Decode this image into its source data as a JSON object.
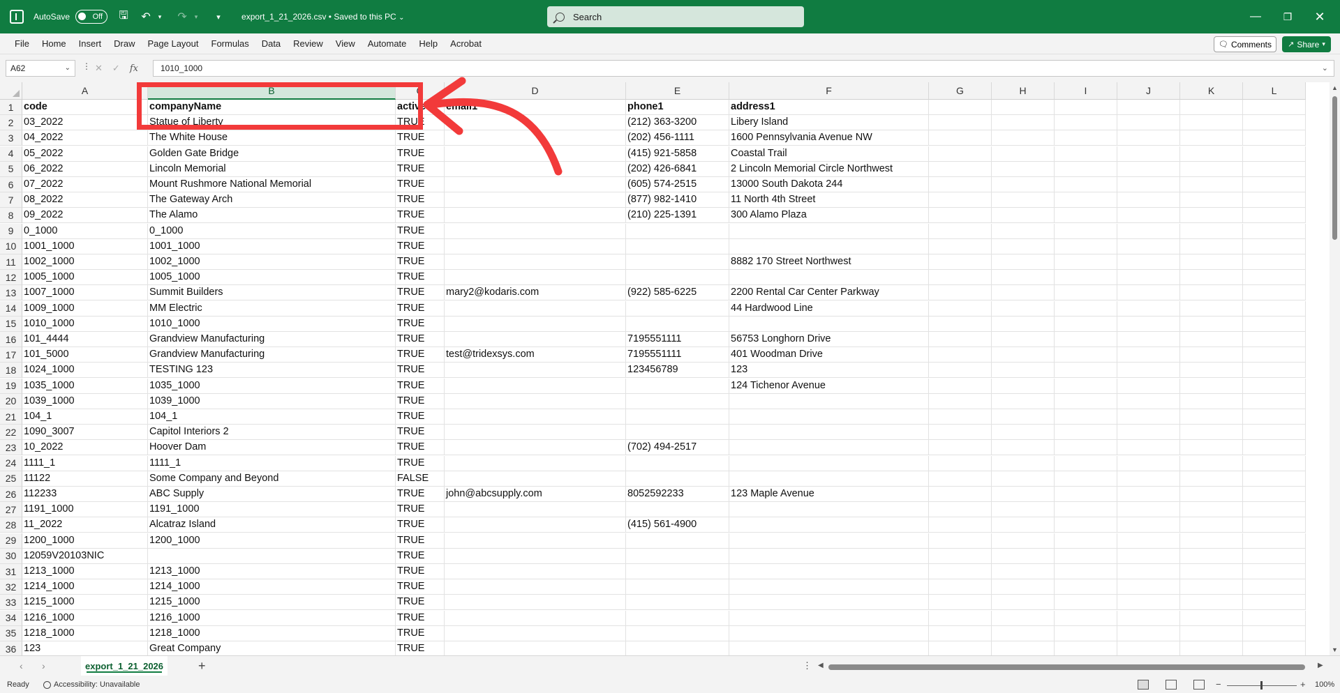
{
  "titlebar": {
    "autosave_label": "AutoSave",
    "autosave_state": "Off",
    "filename": "export_1_21_2026.csv • Saved to this PC",
    "search_placeholder": "Search"
  },
  "menu": [
    "File",
    "Home",
    "Insert",
    "Draw",
    "Page Layout",
    "Formulas",
    "Data",
    "Review",
    "View",
    "Automate",
    "Help",
    "Acrobat"
  ],
  "menu_buttons": {
    "comments": "Comments",
    "share": "Share"
  },
  "formula_bar": {
    "name_box": "A62",
    "formula": "1010_1000"
  },
  "columns": [
    {
      "letter": "A"
    },
    {
      "letter": "B"
    },
    {
      "letter": "C"
    },
    {
      "letter": "D"
    },
    {
      "letter": "E"
    },
    {
      "letter": "F"
    },
    {
      "letter": "G"
    },
    {
      "letter": "H"
    },
    {
      "letter": "I"
    },
    {
      "letter": "J"
    },
    {
      "letter": "K"
    },
    {
      "letter": "L"
    }
  ],
  "rows": [
    {
      "num": "1",
      "cells": [
        "code",
        "companyName",
        "active",
        "email1",
        "phone1",
        "address1"
      ]
    },
    {
      "num": "2",
      "cells": [
        "03_2022",
        "Statue of Liberty",
        "TRUE",
        "",
        "(212) 363-3200",
        "Libery Island"
      ]
    },
    {
      "num": "3",
      "cells": [
        "04_2022",
        "The White House",
        "TRUE",
        "",
        "(202) 456-1111",
        "1600 Pennsylvania Avenue NW"
      ]
    },
    {
      "num": "4",
      "cells": [
        "05_2022",
        "Golden Gate Bridge",
        "TRUE",
        "",
        "(415) 921-5858",
        "Coastal Trail"
      ]
    },
    {
      "num": "5",
      "cells": [
        "06_2022",
        "Lincoln Memorial",
        "TRUE",
        "",
        "(202) 426-6841",
        "2 Lincoln Memorial Circle Northwest"
      ]
    },
    {
      "num": "6",
      "cells": [
        "07_2022",
        "Mount Rushmore National Memorial",
        "TRUE",
        "",
        "(605) 574-2515",
        "13000 South Dakota 244"
      ]
    },
    {
      "num": "7",
      "cells": [
        "08_2022",
        "The Gateway Arch",
        "TRUE",
        "",
        "(877) 982-1410",
        "11 North 4th Street"
      ]
    },
    {
      "num": "8",
      "cells": [
        "09_2022",
        "The Alamo",
        "TRUE",
        "",
        "(210) 225-1391",
        "300 Alamo Plaza"
      ]
    },
    {
      "num": "9",
      "cells": [
        "0_1000",
        "0_1000",
        "TRUE",
        "",
        "",
        ""
      ]
    },
    {
      "num": "10",
      "cells": [
        "1001_1000",
        "1001_1000",
        "TRUE",
        "",
        "",
        ""
      ]
    },
    {
      "num": "11",
      "cells": [
        "1002_1000",
        "1002_1000",
        "TRUE",
        "",
        "",
        "8882 170 Street Northwest"
      ]
    },
    {
      "num": "12",
      "cells": [
        "1005_1000",
        "1005_1000",
        "TRUE",
        "",
        "",
        ""
      ]
    },
    {
      "num": "13",
      "cells": [
        "1007_1000",
        "Summit Builders",
        "TRUE",
        "mary2@kodaris.com",
        "(922) 585-6225",
        "2200 Rental Car Center Parkway"
      ]
    },
    {
      "num": "14",
      "cells": [
        "1009_1000",
        "MM Electric",
        "TRUE",
        "",
        "",
        "44 Hardwood Line"
      ]
    },
    {
      "num": "15",
      "cells": [
        "1010_1000",
        "1010_1000",
        "TRUE",
        "",
        "",
        ""
      ]
    },
    {
      "num": "16",
      "cells": [
        "101_4444",
        "Grandview Manufacturing",
        "TRUE",
        "",
        "7195551111",
        "56753 Longhorn Drive"
      ]
    },
    {
      "num": "17",
      "cells": [
        "101_5000",
        "Grandview Manufacturing",
        "TRUE",
        "test@tridexsys.com",
        "7195551111",
        "401 Woodman Drive"
      ]
    },
    {
      "num": "18",
      "cells": [
        "1024_1000",
        "TESTING 123",
        "TRUE",
        "",
        "123456789",
        "123"
      ]
    },
    {
      "num": "19",
      "cells": [
        "1035_1000",
        "1035_1000",
        "TRUE",
        "",
        "",
        "124 Tichenor Avenue"
      ]
    },
    {
      "num": "20",
      "cells": [
        "1039_1000",
        "1039_1000",
        "TRUE",
        "",
        "",
        ""
      ]
    },
    {
      "num": "21",
      "cells": [
        "104_1",
        "104_1",
        "TRUE",
        "",
        "",
        ""
      ]
    },
    {
      "num": "22",
      "cells": [
        "1090_3007",
        "Capitol Interiors 2",
        "TRUE",
        "",
        "",
        ""
      ]
    },
    {
      "num": "23",
      "cells": [
        "10_2022",
        "Hoover Dam",
        "TRUE",
        "",
        "(702) 494-2517",
        ""
      ]
    },
    {
      "num": "24",
      "cells": [
        "1111_1",
        "1111_1",
        "TRUE",
        "",
        "",
        ""
      ]
    },
    {
      "num": "25",
      "cells": [
        "11122",
        "Some Company and Beyond",
        "FALSE",
        "",
        "",
        ""
      ]
    },
    {
      "num": "26",
      "cells": [
        "112233",
        "ABC Supply",
        "TRUE",
        "john@abcsupply.com",
        "8052592233",
        "123 Maple Avenue"
      ]
    },
    {
      "num": "27",
      "cells": [
        "1191_1000",
        "1191_1000",
        "TRUE",
        "",
        "",
        ""
      ]
    },
    {
      "num": "28",
      "cells": [
        "11_2022",
        "Alcatraz Island",
        "TRUE",
        "",
        "(415) 561-4900",
        ""
      ]
    },
    {
      "num": "29",
      "cells": [
        "1200_1000",
        "1200_1000",
        "TRUE",
        "",
        "",
        ""
      ]
    },
    {
      "num": "30",
      "cells": [
        "12059V20103NIC",
        "",
        "TRUE",
        "",
        "",
        ""
      ]
    },
    {
      "num": "31",
      "cells": [
        "1213_1000",
        "1213_1000",
        "TRUE",
        "",
        "",
        ""
      ]
    },
    {
      "num": "32",
      "cells": [
        "1214_1000",
        "1214_1000",
        "TRUE",
        "",
        "",
        ""
      ]
    },
    {
      "num": "33",
      "cells": [
        "1215_1000",
        "1215_1000",
        "TRUE",
        "",
        "",
        ""
      ]
    },
    {
      "num": "34",
      "cells": [
        "1216_1000",
        "1216_1000",
        "TRUE",
        "",
        "",
        ""
      ]
    },
    {
      "num": "35",
      "cells": [
        "1218_1000",
        "1218_1000",
        "TRUE",
        "",
        "",
        ""
      ]
    },
    {
      "num": "36",
      "cells": [
        "123",
        "Great Company",
        "TRUE",
        "",
        "",
        ""
      ]
    }
  ],
  "sheet_tabs": [
    "export_1_21_2026"
  ],
  "status": {
    "ready": "Ready",
    "accessibility": "Accessibility: Unavailable",
    "zoom": "100%"
  },
  "icons": {
    "undo": "undo-icon",
    "redo": "redo-icon",
    "save": "save-icon",
    "search": "search-icon",
    "minimize": "minimize-icon",
    "restore": "restore-icon",
    "close": "close-icon"
  },
  "colors": {
    "brand": "#107c41",
    "annotation": "#f23a3a"
  }
}
